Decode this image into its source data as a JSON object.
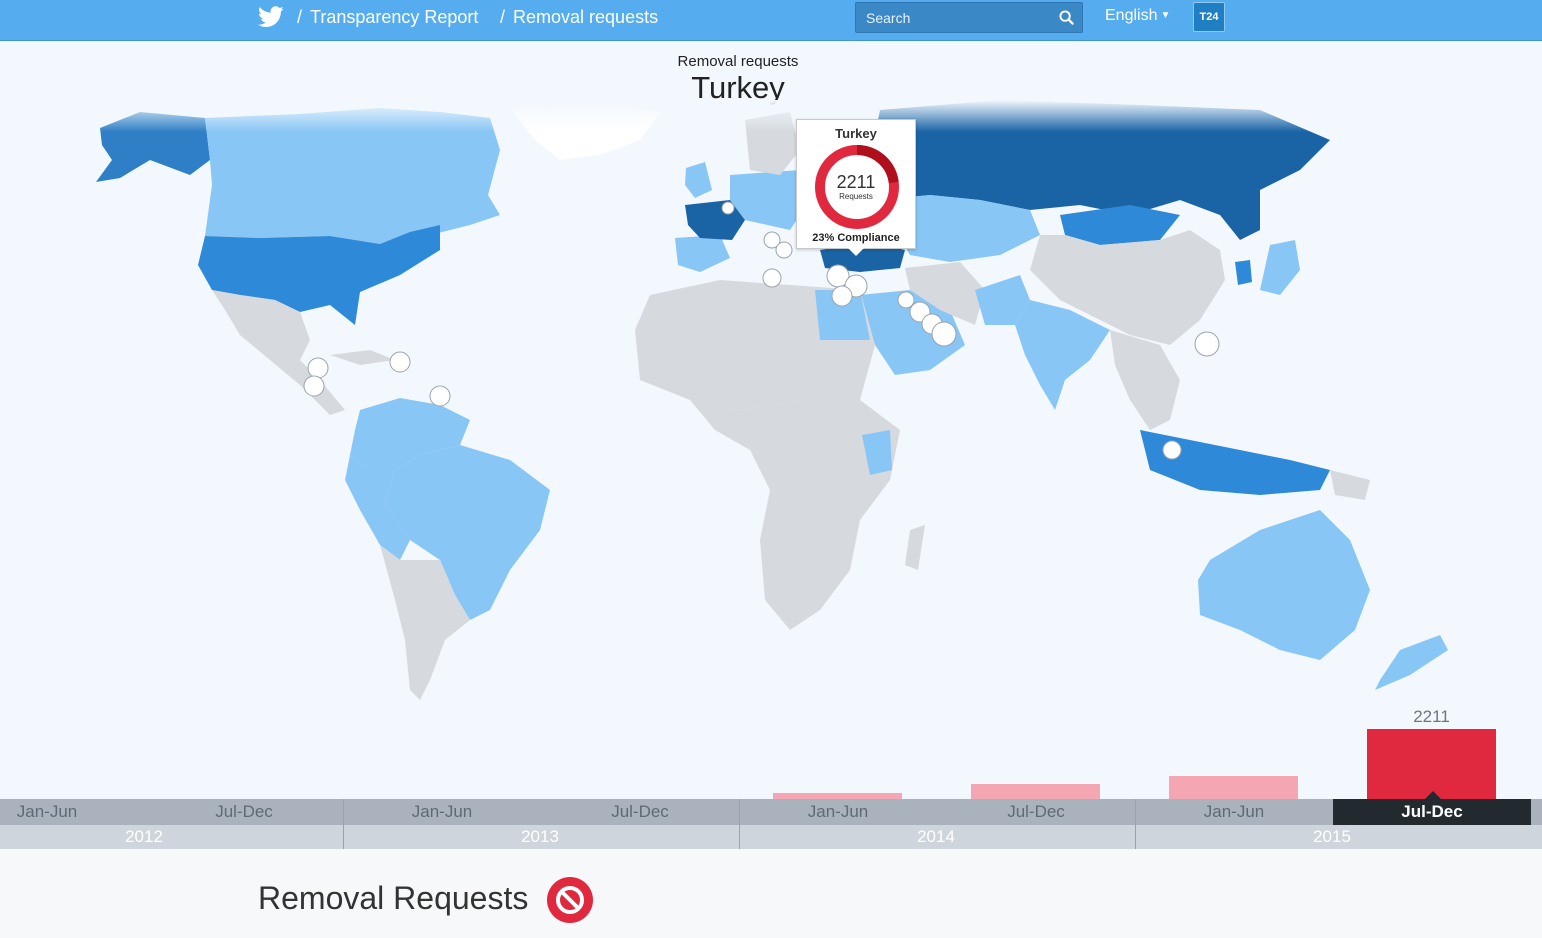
{
  "header": {
    "breadcrumb": [
      {
        "label": "Transparency Report"
      },
      {
        "label": "Removal requests"
      }
    ],
    "search_placeholder": "Search",
    "language": "English",
    "avatar_text": "T24",
    "brand_color": "#55acee"
  },
  "heading": {
    "subtitle": "Removal requests",
    "country": "Turkey"
  },
  "tooltip": {
    "country": "Turkey",
    "requests": "2211",
    "requests_label": "Requests",
    "compliance": "23% Compliance",
    "compliance_fraction": 0.23,
    "colors": {
      "complied": "#b0101e",
      "not_complied": "#e0283f"
    }
  },
  "timeline": {
    "years": [
      "2012",
      "2013",
      "2014",
      "2015"
    ],
    "periods": [
      {
        "label": "Jan-Jun",
        "year": "2012",
        "requests": 0
      },
      {
        "label": "Jul-Dec",
        "year": "2012",
        "requests": 0
      },
      {
        "label": "Jan-Jun",
        "year": "2013",
        "requests": 0
      },
      {
        "label": "Jul-Dec",
        "year": "2013",
        "requests": 0
      },
      {
        "label": "Jan-Jun",
        "year": "2014",
        "requests": 186
      },
      {
        "label": "Jul-Dec",
        "year": "2014",
        "requests": 477
      },
      {
        "label": "Jan-Jun",
        "year": "2015",
        "requests": 718
      },
      {
        "label": "Jul-Dec",
        "year": "2015",
        "requests": 2211
      }
    ],
    "selected_value_label": "2211",
    "colors": {
      "selected": "#e0283f",
      "other": "#f4a6b3"
    }
  },
  "section": {
    "title": "Removal Requests",
    "icon": "ban-icon"
  }
}
